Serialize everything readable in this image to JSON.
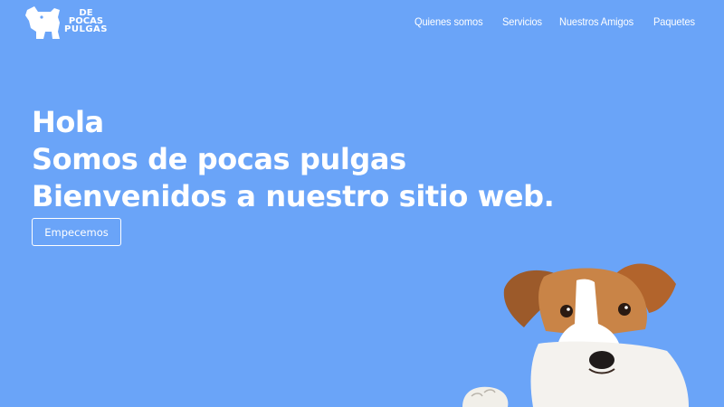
{
  "brand": {
    "logo_line1": "DE",
    "logo_line2": "POCAS",
    "logo_line3": "PULGAS"
  },
  "nav": {
    "items": [
      {
        "label": "Quienes somos"
      },
      {
        "label": "Servicios"
      },
      {
        "label": "Nuestros Amigos"
      },
      {
        "label": "Paquetes"
      }
    ]
  },
  "hero": {
    "line1": "Hola",
    "line2": "Somos de pocas pulgas",
    "line3": "Bienvenidos a nuestro sitio web.",
    "cta_label": "Empecemos"
  },
  "colors": {
    "background": "#6aa4f8",
    "text": "#ffffff"
  },
  "icons": {
    "logo": "dog-silhouette-icon",
    "hero_image": "jack-russell-dog"
  }
}
